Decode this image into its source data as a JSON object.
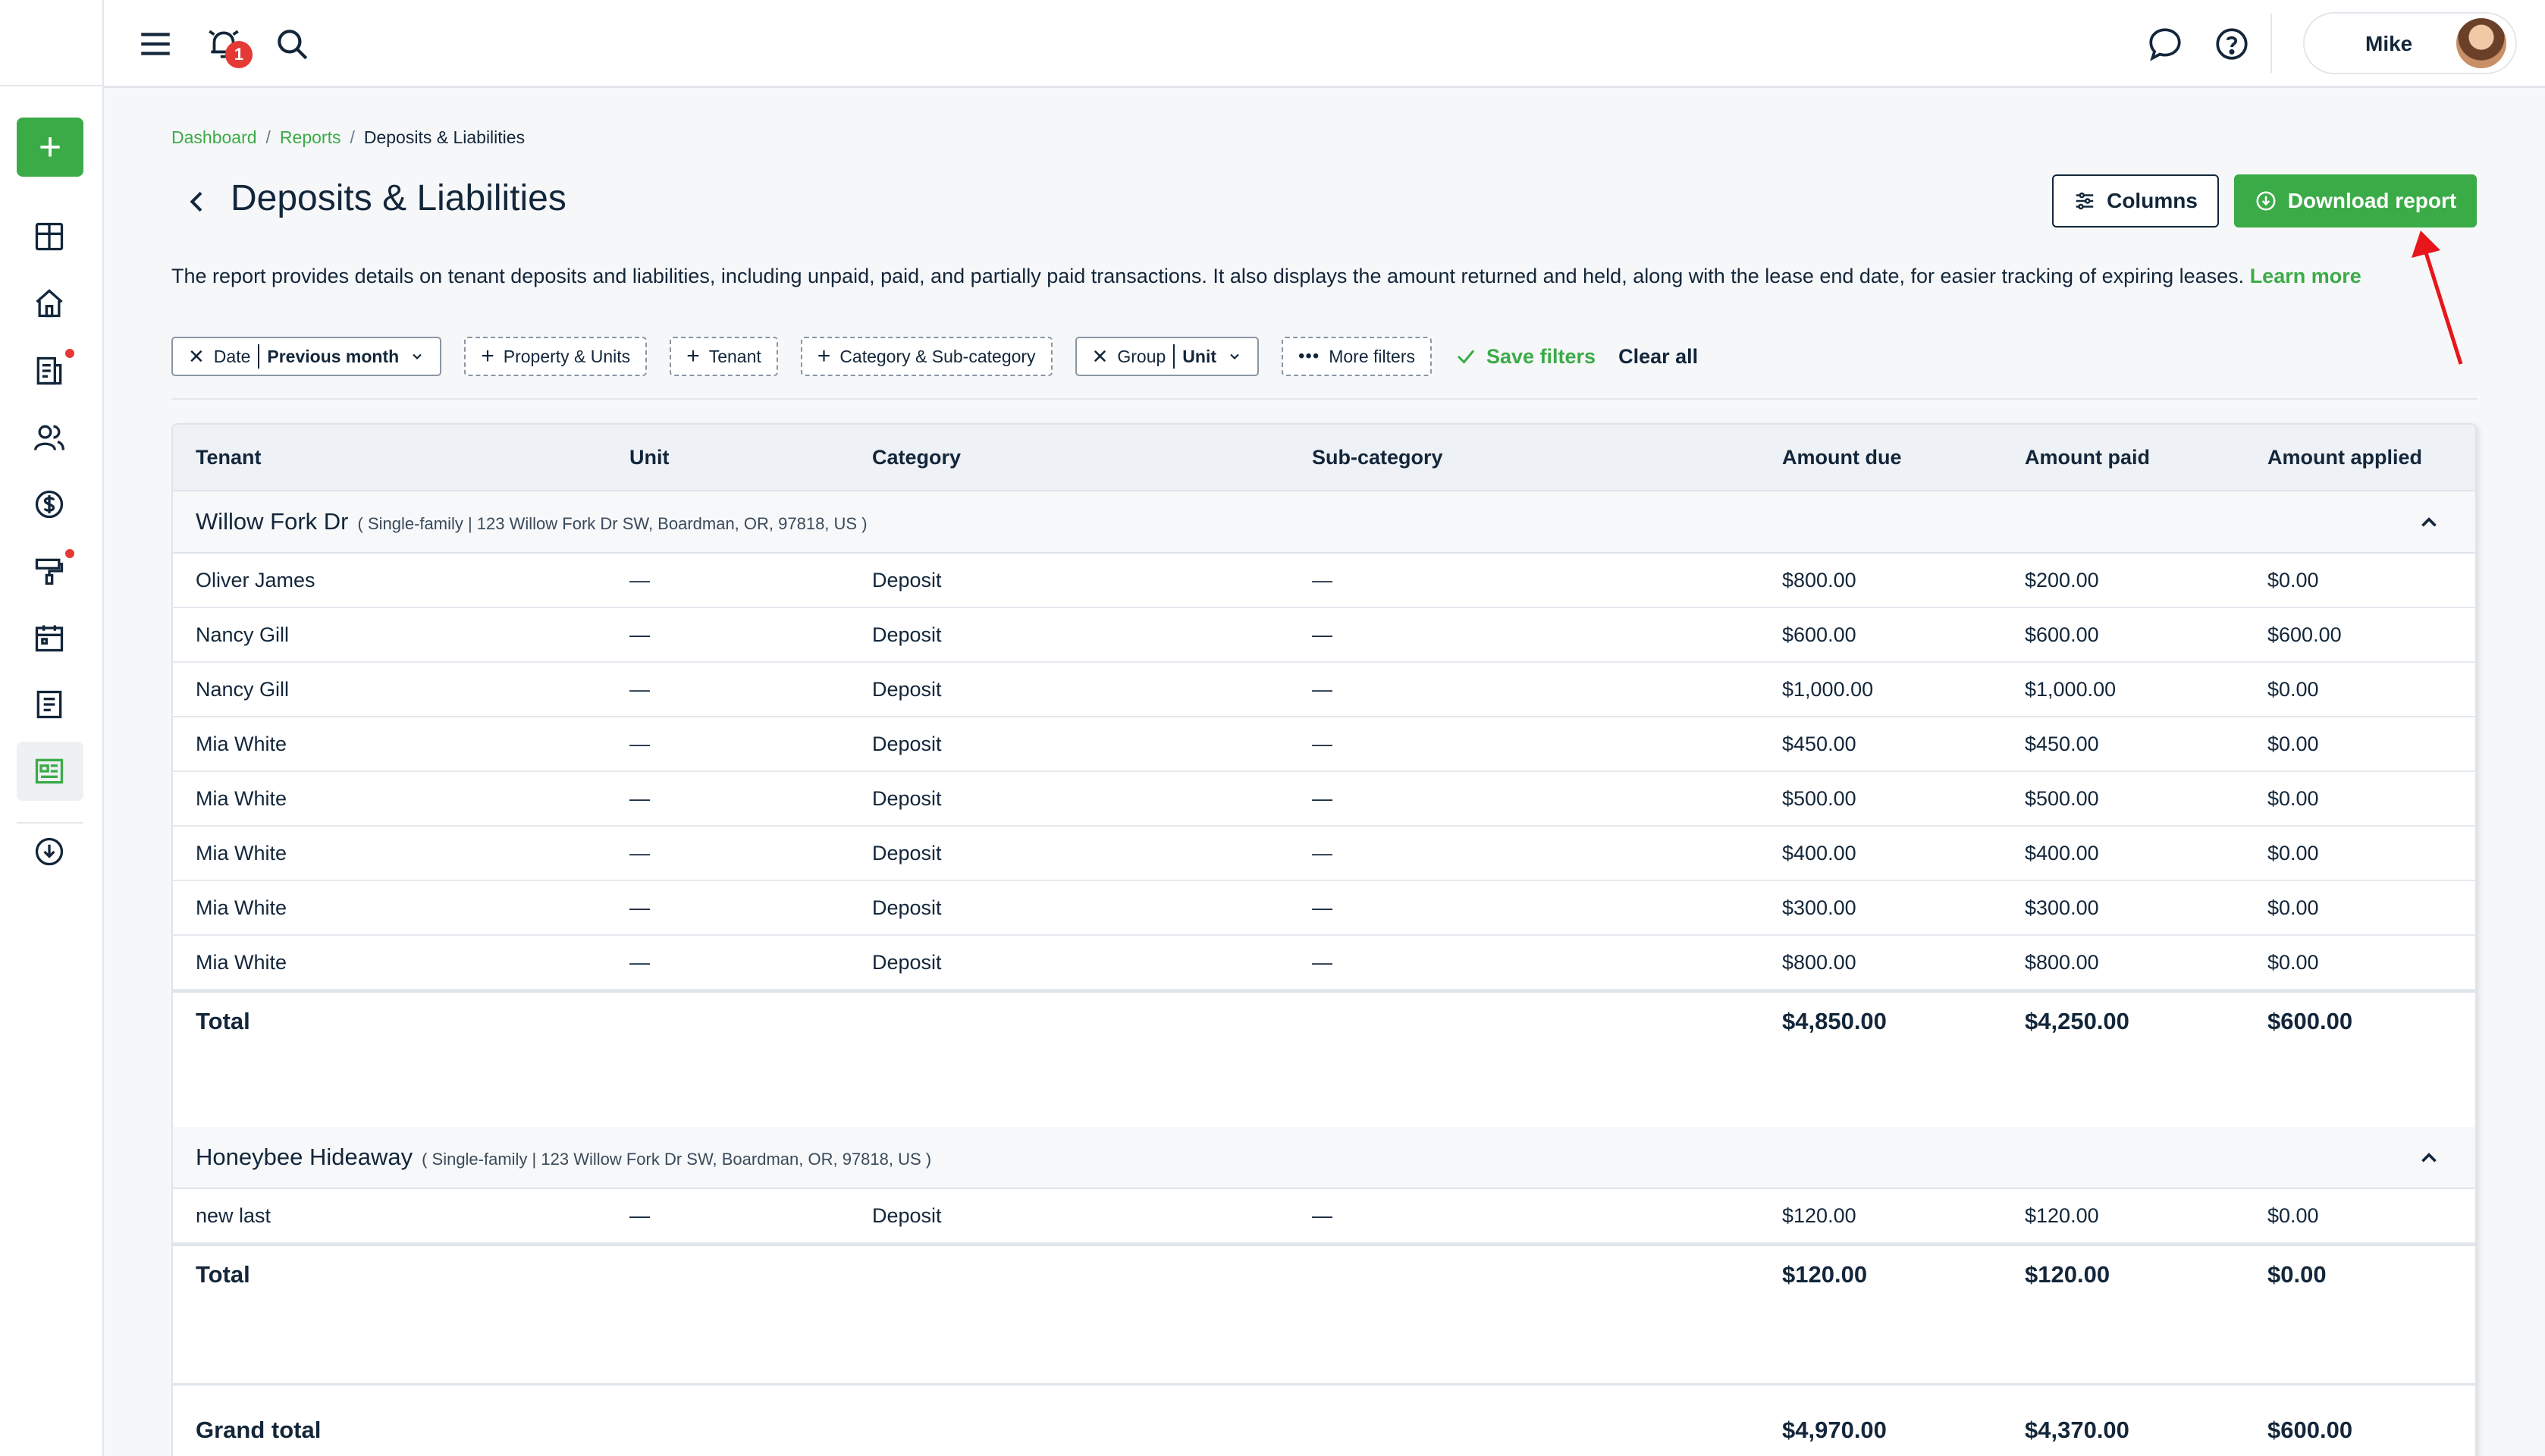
{
  "topbar": {
    "notification_count": "1",
    "user_name": "Mike"
  },
  "breadcrumb": [
    "Dashboard",
    "Reports",
    "Deposits & Liabilities"
  ],
  "page": {
    "title": "Deposits & Liabilities",
    "columns_label": "Columns",
    "download_label": "Download report",
    "description": "The report provides details on tenant deposits and liabilities, including unpaid, paid, and partially paid transactions. It also displays the amount returned and held, along with the lease end date, for easier tracking of expiring leases.",
    "learn_more": "Learn more"
  },
  "filters": {
    "date_label": "Date",
    "date_value": "Previous month",
    "property_units": "Property & Units",
    "tenant": "Tenant",
    "category": "Category & Sub-category",
    "group_label": "Group",
    "group_value": "Unit",
    "more_filters": "More filters",
    "save_filters": "Save filters",
    "clear_all": "Clear all"
  },
  "table": {
    "columns": [
      "Tenant",
      "Unit",
      "Category",
      "Sub-category",
      "Amount due",
      "Amount paid",
      "Amount applied"
    ],
    "groups": [
      {
        "name": "Willow Fork Dr",
        "address": "( Single-family | 123 Willow Fork Dr SW, Boardman, OR, 97818, US )",
        "rows": [
          [
            "Oliver James",
            "—",
            "Deposit",
            "—",
            "$800.00",
            "$200.00",
            "$0.00"
          ],
          [
            "Nancy Gill",
            "—",
            "Deposit",
            "—",
            "$600.00",
            "$600.00",
            "$600.00"
          ],
          [
            "Nancy Gill",
            "—",
            "Deposit",
            "—",
            "$1,000.00",
            "$1,000.00",
            "$0.00"
          ],
          [
            "Mia White",
            "—",
            "Deposit",
            "—",
            "$450.00",
            "$450.00",
            "$0.00"
          ],
          [
            "Mia White",
            "—",
            "Deposit",
            "—",
            "$500.00",
            "$500.00",
            "$0.00"
          ],
          [
            "Mia White",
            "—",
            "Deposit",
            "—",
            "$400.00",
            "$400.00",
            "$0.00"
          ],
          [
            "Mia White",
            "—",
            "Deposit",
            "—",
            "$300.00",
            "$300.00",
            "$0.00"
          ],
          [
            "Mia White",
            "—",
            "Deposit",
            "—",
            "$800.00",
            "$800.00",
            "$0.00"
          ]
        ],
        "total_label": "Total",
        "total": [
          "$4,850.00",
          "$4,250.00",
          "$600.00"
        ]
      },
      {
        "name": "Honeybee Hideaway",
        "address": "( Single-family | 123 Willow Fork Dr SW, Boardman, OR, 97818, US )",
        "rows": [
          [
            "new last",
            "—",
            "Deposit",
            "—",
            "$120.00",
            "$120.00",
            "$0.00"
          ]
        ],
        "total_label": "Total",
        "total": [
          "$120.00",
          "$120.00",
          "$0.00"
        ]
      }
    ],
    "grand_total_label": "Grand total",
    "grand_total": [
      "$4,970.00",
      "$4,370.00",
      "$600.00"
    ]
  },
  "colors": {
    "brand_green": "#3bab47",
    "text_dark": "#13263a",
    "alert_red": "#e53935"
  }
}
